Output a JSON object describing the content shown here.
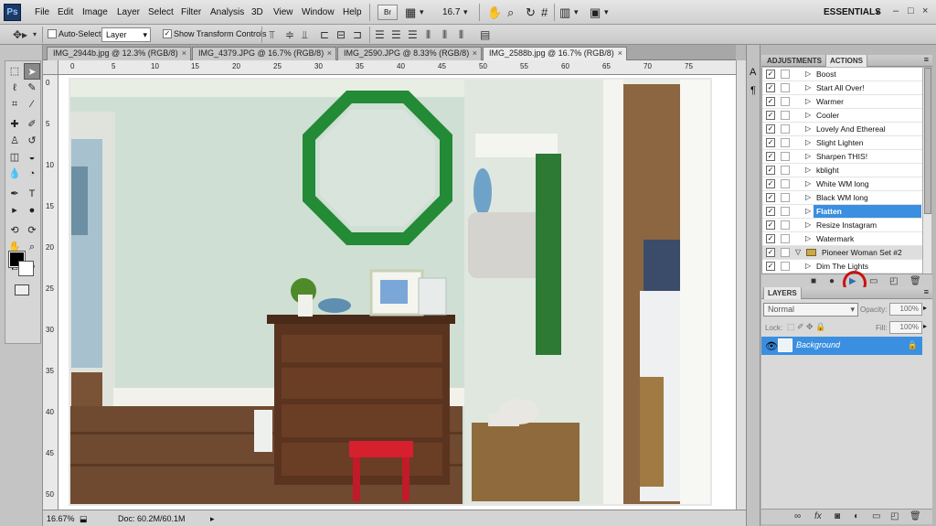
{
  "menubar": {
    "logo": "Ps",
    "menus": [
      "File",
      "Edit",
      "Image",
      "Layer",
      "Select",
      "Filter",
      "Analysis",
      "3D",
      "View",
      "Window",
      "Help"
    ],
    "bridge_button": "Br",
    "zoom_value": "16.7",
    "workspace": "ESSENTIALS",
    "window_controls": [
      "–",
      "□",
      "×"
    ]
  },
  "options": {
    "auto_select_label": "Auto-Select:",
    "auto_select_target": "Layer",
    "show_transform_label": "Show Transform Controls"
  },
  "tabs": [
    {
      "label": "IMG_2944b.jpg @ 12.3% (RGB/8)"
    },
    {
      "label": "IMG_4379.JPG @ 16.7% (RGB/8)"
    },
    {
      "label": "IMG_2590.JPG @ 8.33% (RGB/8)"
    },
    {
      "label": "IMG_2588b.jpg @ 16.7% (RGB/8)"
    }
  ],
  "ruler_top": [
    "0",
    "5",
    "10",
    "15",
    "20",
    "25",
    "30",
    "35",
    "40",
    "45",
    "50",
    "55",
    "60",
    "65",
    "70",
    "75"
  ],
  "ruler_left": [
    "0",
    "5",
    "10",
    "15",
    "20",
    "25",
    "30",
    "35",
    "40",
    "45",
    "50"
  ],
  "status": {
    "zoom": "16.67%",
    "doc": "Doc: 60.2M/60.1M"
  },
  "actions_panel": {
    "tab_adjustments": "ADJUSTMENTS",
    "tab_actions": "ACTIONS",
    "items": [
      {
        "label": "Boost"
      },
      {
        "label": "Start All Over!"
      },
      {
        "label": "Warmer"
      },
      {
        "label": "Cooler"
      },
      {
        "label": "Lovely And Ethereal"
      },
      {
        "label": "Slight Lighten"
      },
      {
        "label": "Sharpen THIS!"
      },
      {
        "label": "kblight"
      },
      {
        "label": "White WM long"
      },
      {
        "label": "Black WM long"
      },
      {
        "label": "Flatten"
      },
      {
        "label": "Resize Instagram"
      },
      {
        "label": "Watermark"
      },
      {
        "label": "Pioneer Woman Set #2"
      },
      {
        "label": "Dim The Lights"
      }
    ]
  },
  "layers_panel": {
    "tab": "LAYERS",
    "blend_mode": "Normal",
    "opacity_label": "Opacity:",
    "opacity_value": "100%",
    "lock_label": "Lock:",
    "fill_label": "Fill:",
    "fill_value": "100%",
    "layers": [
      {
        "name": "Background"
      }
    ]
  },
  "colors": {
    "accent": "#3a8fe0",
    "annotation": "#cc1010",
    "foreground": "#000000",
    "background": "#ffffff"
  }
}
